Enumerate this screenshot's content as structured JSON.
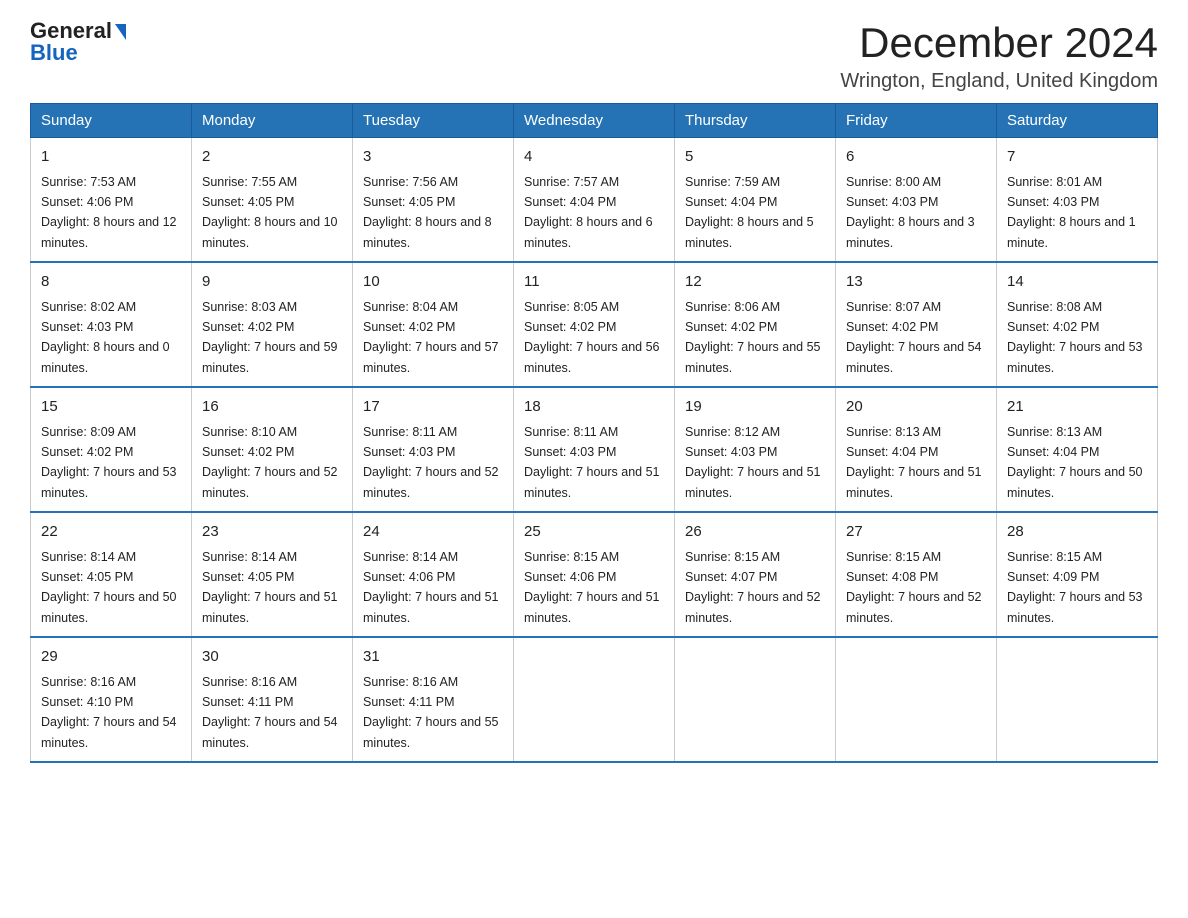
{
  "logo": {
    "general": "General",
    "blue": "Blue",
    "triangle": "▶"
  },
  "title": "December 2024",
  "subtitle": "Wrington, England, United Kingdom",
  "days_of_week": [
    "Sunday",
    "Monday",
    "Tuesday",
    "Wednesday",
    "Thursday",
    "Friday",
    "Saturday"
  ],
  "weeks": [
    [
      {
        "day": "1",
        "sunrise": "7:53 AM",
        "sunset": "4:06 PM",
        "daylight": "8 hours and 12 minutes."
      },
      {
        "day": "2",
        "sunrise": "7:55 AM",
        "sunset": "4:05 PM",
        "daylight": "8 hours and 10 minutes."
      },
      {
        "day": "3",
        "sunrise": "7:56 AM",
        "sunset": "4:05 PM",
        "daylight": "8 hours and 8 minutes."
      },
      {
        "day": "4",
        "sunrise": "7:57 AM",
        "sunset": "4:04 PM",
        "daylight": "8 hours and 6 minutes."
      },
      {
        "day": "5",
        "sunrise": "7:59 AM",
        "sunset": "4:04 PM",
        "daylight": "8 hours and 5 minutes."
      },
      {
        "day": "6",
        "sunrise": "8:00 AM",
        "sunset": "4:03 PM",
        "daylight": "8 hours and 3 minutes."
      },
      {
        "day": "7",
        "sunrise": "8:01 AM",
        "sunset": "4:03 PM",
        "daylight": "8 hours and 1 minute."
      }
    ],
    [
      {
        "day": "8",
        "sunrise": "8:02 AM",
        "sunset": "4:03 PM",
        "daylight": "8 hours and 0 minutes."
      },
      {
        "day": "9",
        "sunrise": "8:03 AM",
        "sunset": "4:02 PM",
        "daylight": "7 hours and 59 minutes."
      },
      {
        "day": "10",
        "sunrise": "8:04 AM",
        "sunset": "4:02 PM",
        "daylight": "7 hours and 57 minutes."
      },
      {
        "day": "11",
        "sunrise": "8:05 AM",
        "sunset": "4:02 PM",
        "daylight": "7 hours and 56 minutes."
      },
      {
        "day": "12",
        "sunrise": "8:06 AM",
        "sunset": "4:02 PM",
        "daylight": "7 hours and 55 minutes."
      },
      {
        "day": "13",
        "sunrise": "8:07 AM",
        "sunset": "4:02 PM",
        "daylight": "7 hours and 54 minutes."
      },
      {
        "day": "14",
        "sunrise": "8:08 AM",
        "sunset": "4:02 PM",
        "daylight": "7 hours and 53 minutes."
      }
    ],
    [
      {
        "day": "15",
        "sunrise": "8:09 AM",
        "sunset": "4:02 PM",
        "daylight": "7 hours and 53 minutes."
      },
      {
        "day": "16",
        "sunrise": "8:10 AM",
        "sunset": "4:02 PM",
        "daylight": "7 hours and 52 minutes."
      },
      {
        "day": "17",
        "sunrise": "8:11 AM",
        "sunset": "4:03 PM",
        "daylight": "7 hours and 52 minutes."
      },
      {
        "day": "18",
        "sunrise": "8:11 AM",
        "sunset": "4:03 PM",
        "daylight": "7 hours and 51 minutes."
      },
      {
        "day": "19",
        "sunrise": "8:12 AM",
        "sunset": "4:03 PM",
        "daylight": "7 hours and 51 minutes."
      },
      {
        "day": "20",
        "sunrise": "8:13 AM",
        "sunset": "4:04 PM",
        "daylight": "7 hours and 51 minutes."
      },
      {
        "day": "21",
        "sunrise": "8:13 AM",
        "sunset": "4:04 PM",
        "daylight": "7 hours and 50 minutes."
      }
    ],
    [
      {
        "day": "22",
        "sunrise": "8:14 AM",
        "sunset": "4:05 PM",
        "daylight": "7 hours and 50 minutes."
      },
      {
        "day": "23",
        "sunrise": "8:14 AM",
        "sunset": "4:05 PM",
        "daylight": "7 hours and 51 minutes."
      },
      {
        "day": "24",
        "sunrise": "8:14 AM",
        "sunset": "4:06 PM",
        "daylight": "7 hours and 51 minutes."
      },
      {
        "day": "25",
        "sunrise": "8:15 AM",
        "sunset": "4:06 PM",
        "daylight": "7 hours and 51 minutes."
      },
      {
        "day": "26",
        "sunrise": "8:15 AM",
        "sunset": "4:07 PM",
        "daylight": "7 hours and 52 minutes."
      },
      {
        "day": "27",
        "sunrise": "8:15 AM",
        "sunset": "4:08 PM",
        "daylight": "7 hours and 52 minutes."
      },
      {
        "day": "28",
        "sunrise": "8:15 AM",
        "sunset": "4:09 PM",
        "daylight": "7 hours and 53 minutes."
      }
    ],
    [
      {
        "day": "29",
        "sunrise": "8:16 AM",
        "sunset": "4:10 PM",
        "daylight": "7 hours and 54 minutes."
      },
      {
        "day": "30",
        "sunrise": "8:16 AM",
        "sunset": "4:11 PM",
        "daylight": "7 hours and 54 minutes."
      },
      {
        "day": "31",
        "sunrise": "8:16 AM",
        "sunset": "4:11 PM",
        "daylight": "7 hours and 55 minutes."
      },
      null,
      null,
      null,
      null
    ]
  ]
}
